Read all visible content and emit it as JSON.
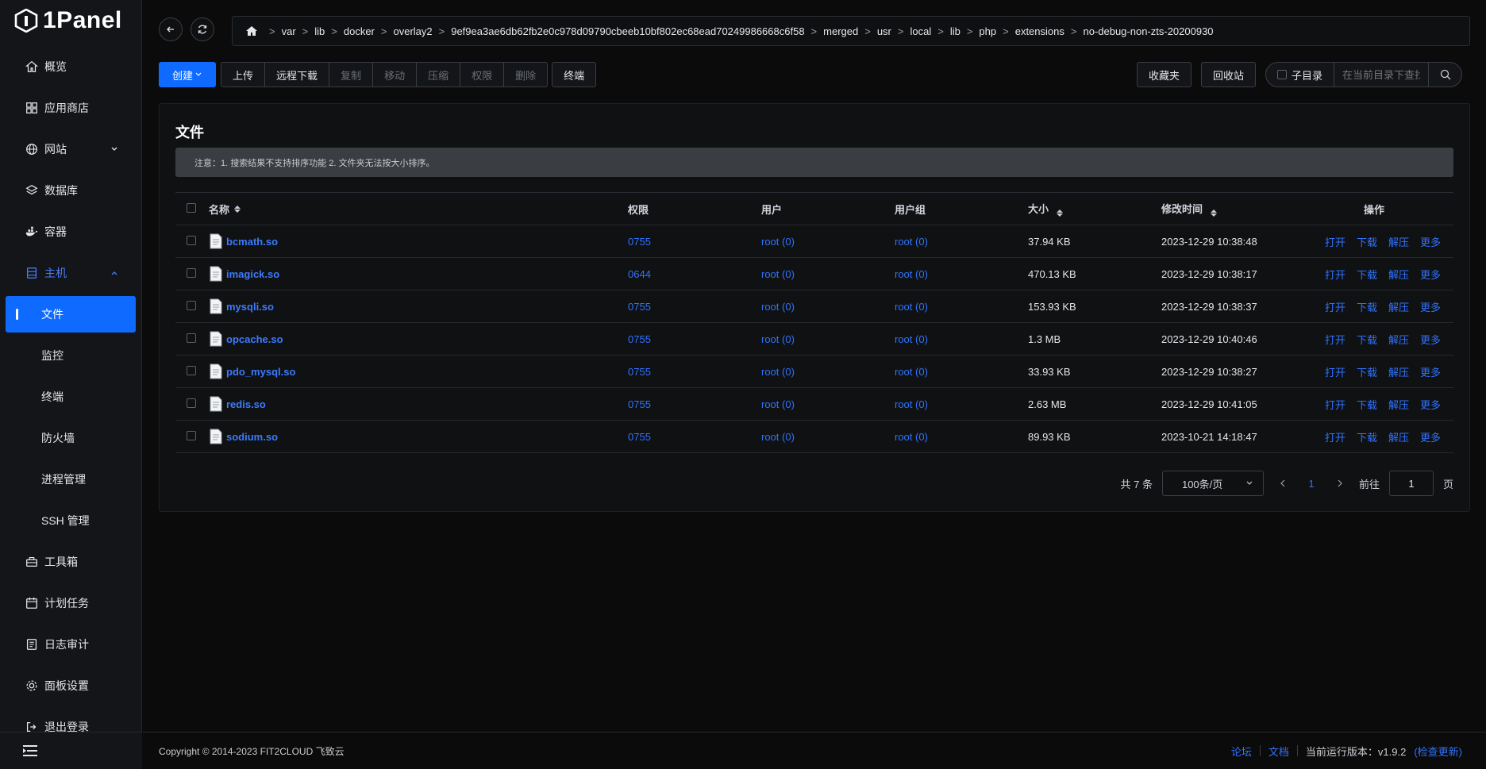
{
  "app": {
    "logo_text": "1Panel"
  },
  "sidebar": {
    "items": [
      {
        "label": "概览",
        "icon": "home-icon"
      },
      {
        "label": "应用商店",
        "icon": "apps-icon"
      },
      {
        "label": "网站",
        "icon": "globe-icon",
        "has_caret": true
      },
      {
        "label": "数据库",
        "icon": "layers-icon"
      },
      {
        "label": "容器",
        "icon": "docker-icon"
      },
      {
        "label": "主机",
        "icon": "server-icon",
        "open": true
      }
    ],
    "sub_items": [
      {
        "label": "文件",
        "active": true
      },
      {
        "label": "监控"
      },
      {
        "label": "终端"
      },
      {
        "label": "防火墙"
      },
      {
        "label": "进程管理"
      },
      {
        "label": "SSH 管理"
      }
    ],
    "bottom_items": [
      {
        "label": "工具箱",
        "icon": "toolbox-icon"
      },
      {
        "label": "计划任务",
        "icon": "calendar-icon"
      },
      {
        "label": "日志审计",
        "icon": "log-icon"
      },
      {
        "label": "面板设置",
        "icon": "gear-icon"
      },
      {
        "label": "退出登录",
        "icon": "logout-icon"
      }
    ]
  },
  "breadcrumb": [
    "var",
    "lib",
    "docker",
    "overlay2",
    "9ef9ea3ae6db62fb2e0c978d09790cbeeb10bf802ec68ead70249986668c6f58",
    "merged",
    "usr",
    "local",
    "lib",
    "php",
    "extensions",
    "no-debug-non-zts-20200930"
  ],
  "breadcrumb_sep": ">",
  "toolbar": {
    "create": "创建",
    "group": [
      {
        "label": "上传",
        "disabled": false
      },
      {
        "label": "远程下载",
        "disabled": false
      },
      {
        "label": "复制",
        "disabled": true
      },
      {
        "label": "移动",
        "disabled": true
      },
      {
        "label": "压缩",
        "disabled": true
      },
      {
        "label": "权限",
        "disabled": true
      },
      {
        "label": "删除",
        "disabled": true
      }
    ],
    "terminal": "终端",
    "favorites": "收藏夹",
    "recycle": "回收站",
    "subdir": "子目录",
    "search_placeholder": "在当前目录下查找文件"
  },
  "card": {
    "title": "文件",
    "notice": "注意：1. 搜索结果不支持排序功能 2. 文件夹无法按大小排序。"
  },
  "table": {
    "headers": {
      "name": "名称",
      "perm": "权限",
      "user": "用户",
      "group": "用户组",
      "size": "大小",
      "time": "修改时间",
      "ops": "操作"
    },
    "ops": [
      "打开",
      "下载",
      "解压",
      "更多"
    ],
    "rows": [
      {
        "name": "bcmath.so",
        "perm": "0755",
        "user": "root (0)",
        "group": "root (0)",
        "size": "37.94 KB",
        "time": "2023-12-29 10:38:48"
      },
      {
        "name": "imagick.so",
        "perm": "0644",
        "user": "root (0)",
        "group": "root (0)",
        "size": "470.13 KB",
        "time": "2023-12-29 10:38:17"
      },
      {
        "name": "mysqli.so",
        "perm": "0755",
        "user": "root (0)",
        "group": "root (0)",
        "size": "153.93 KB",
        "time": "2023-12-29 10:38:37"
      },
      {
        "name": "opcache.so",
        "perm": "0755",
        "user": "root (0)",
        "group": "root (0)",
        "size": "1.3 MB",
        "time": "2023-12-29 10:40:46"
      },
      {
        "name": "pdo_mysql.so",
        "perm": "0755",
        "user": "root (0)",
        "group": "root (0)",
        "size": "33.93 KB",
        "time": "2023-12-29 10:38:27"
      },
      {
        "name": "redis.so",
        "perm": "0755",
        "user": "root (0)",
        "group": "root (0)",
        "size": "2.63 MB",
        "time": "2023-12-29 10:41:05"
      },
      {
        "name": "sodium.so",
        "perm": "0755",
        "user": "root (0)",
        "group": "root (0)",
        "size": "89.93 KB",
        "time": "2023-10-21 14:18:47"
      }
    ]
  },
  "pager": {
    "total": "共 7 条",
    "page_size": "100条/页",
    "current": "1",
    "goto_prefix": "前往",
    "goto_value": "1",
    "goto_suffix": "页"
  },
  "footer": {
    "copyright": "Copyright © 2014-2023 FIT2CLOUD 飞致云",
    "forum": "论坛",
    "docs": "文档",
    "version": "当前运行版本：v1.9.2",
    "check_update": "(检查更新)"
  },
  "colors": {
    "accent": "#0f6bff",
    "link": "#2f73ff",
    "bg": "#0b0b0c",
    "sidebar": "#141518"
  }
}
